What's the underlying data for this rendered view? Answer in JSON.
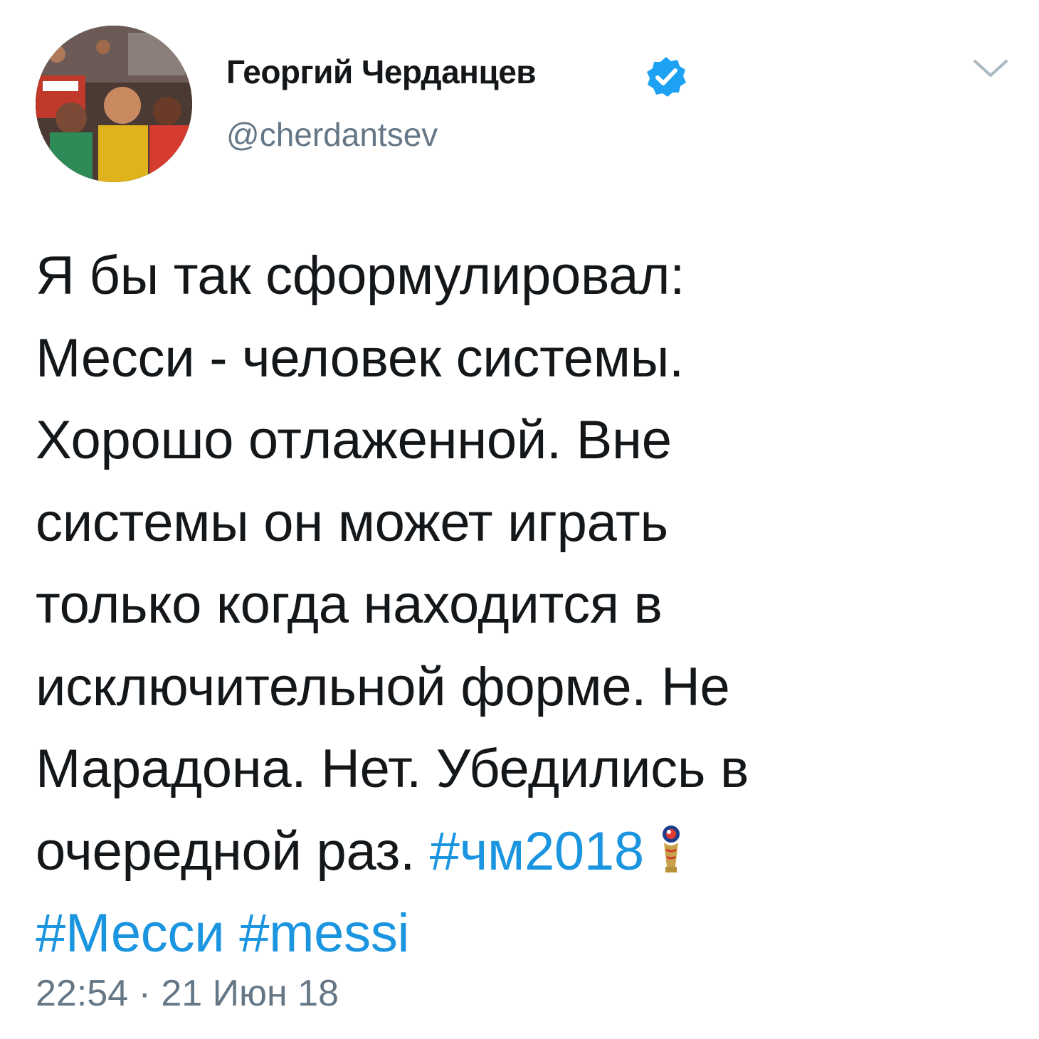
{
  "user": {
    "display_name": "Георгий Черданцев",
    "handle": "@cherdantsev",
    "verified": true,
    "avatar_icon": "avatar-photo"
  },
  "menu": {
    "icon": "chevron-down-icon"
  },
  "tweet": {
    "lines": [
      "Я бы так сформулировал:",
      "Месси - человек системы.",
      "Хорошо отлаженной. Вне",
      "системы он может играть",
      "только когда находится в",
      "исключительной форме. Не",
      "Марадона. Нет. Убедились в"
    ],
    "last_line_text": "очередной раз.",
    "hashtags": [
      "#чм2018",
      "#Месси",
      "#messi"
    ],
    "emoji_icon": "world-cup-2018-emblem-icon",
    "timestamp": "22:54 · 21 Июн 18"
  },
  "colors": {
    "text": "#14171a",
    "secondary": "#657786",
    "link": "#1b95e0",
    "verified_badge": "#1da1f2"
  }
}
